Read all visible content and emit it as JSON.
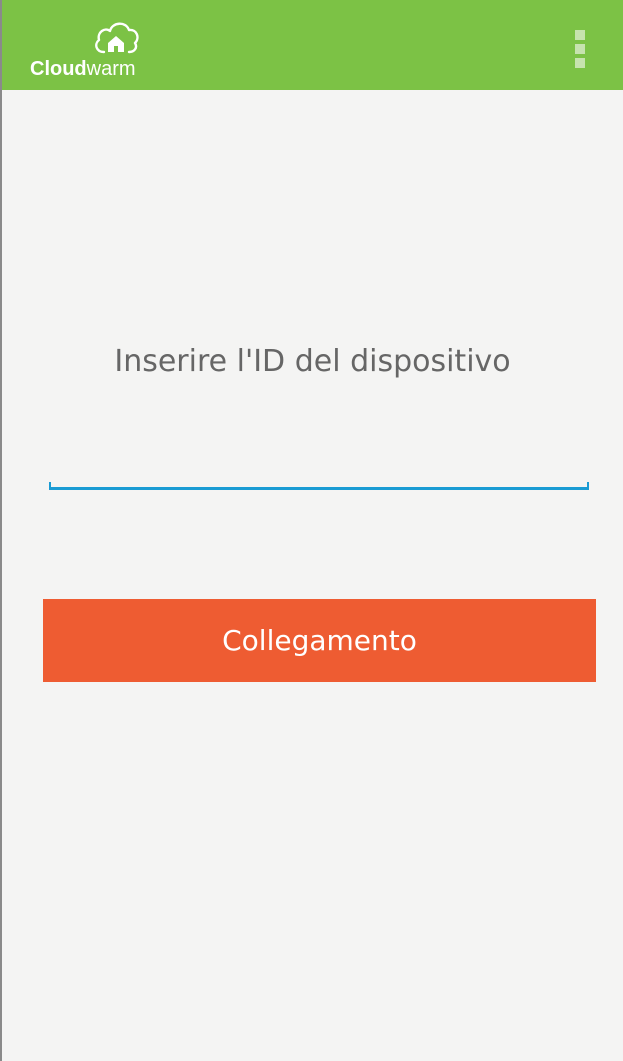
{
  "app_bar": {
    "logo_bold": "Cloud",
    "logo_light": "warm",
    "background_color": "#7cc245",
    "logo_icon": "cloud-house-icon",
    "menu_icon": "overflow-menu-icon"
  },
  "main": {
    "prompt": "Inserire l'ID del dispositivo",
    "device_id_input": {
      "value": "",
      "placeholder": ""
    },
    "connect_button_label": "Collegamento",
    "accent_color": "#1a9bd3",
    "button_color": "#ee5c32"
  }
}
